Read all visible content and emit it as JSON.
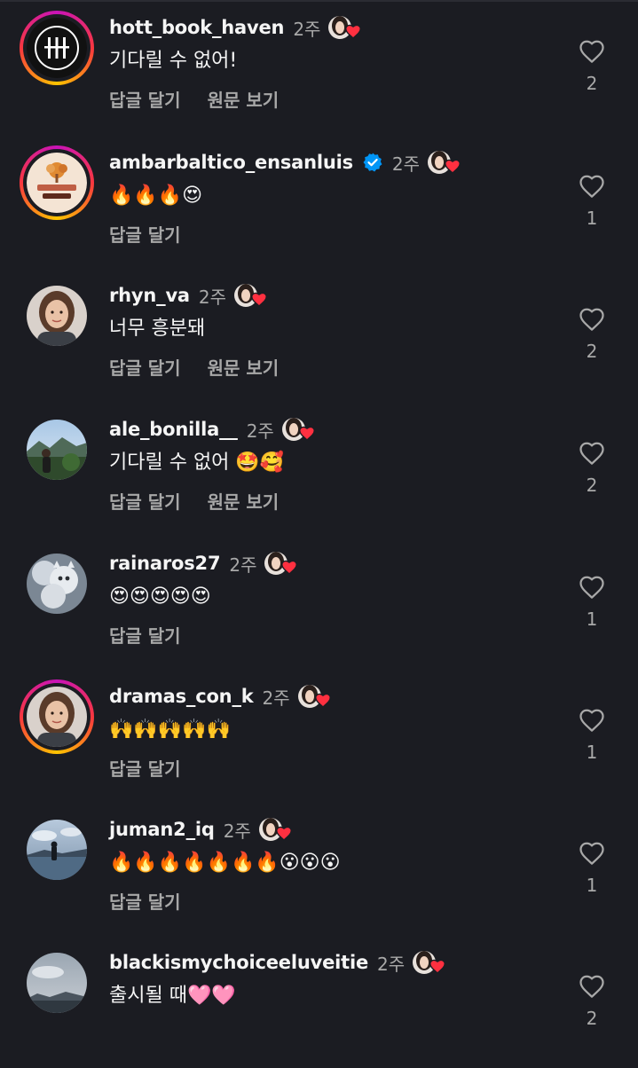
{
  "comments": [
    {
      "username": "hott_book_haven",
      "verified": false,
      "time": "2주",
      "text": "기다릴 수 없어!",
      "reply_label": "답글 달기",
      "translate_label": "원문 보기",
      "likes": "2",
      "story_ring": true,
      "avatar_icon": "books-logo"
    },
    {
      "username": "ambarbaltico_ensanluis",
      "verified": true,
      "time": "2주",
      "text": "🔥🔥🔥😍",
      "reply_label": "답글 달기",
      "translate_label": "",
      "likes": "1",
      "story_ring": true,
      "avatar_icon": "tree-logo"
    },
    {
      "username": "rhyn_va",
      "verified": false,
      "time": "2주",
      "text": "너무 흥분돼",
      "reply_label": "답글 달기",
      "translate_label": "원문 보기",
      "likes": "2",
      "story_ring": false,
      "avatar_icon": "person-photo"
    },
    {
      "username": "ale_bonilla__",
      "verified": false,
      "time": "2주",
      "text": "기다릴 수 없어 🤩🥰",
      "reply_label": "답글 달기",
      "translate_label": "원문 보기",
      "likes": "2",
      "story_ring": false,
      "avatar_icon": "landscape-photo"
    },
    {
      "username": "rainaros27",
      "verified": false,
      "time": "2주",
      "text": "😍😍😍😍😍",
      "reply_label": "답글 달기",
      "translate_label": "",
      "likes": "1",
      "story_ring": false,
      "avatar_icon": "cat-photo"
    },
    {
      "username": "dramas_con_k",
      "verified": false,
      "time": "2주",
      "text": "🙌🙌🙌🙌🙌",
      "reply_label": "답글 달기",
      "translate_label": "",
      "likes": "1",
      "story_ring": true,
      "avatar_icon": "person-photo"
    },
    {
      "username": "juman2_iq",
      "verified": false,
      "time": "2주",
      "text": "🔥🔥🔥🔥🔥🔥🔥😮😮😮",
      "reply_label": "답글 달기",
      "translate_label": "",
      "likes": "1",
      "story_ring": false,
      "avatar_icon": "lake-photo"
    },
    {
      "username": "blackismychoiceeluveitie",
      "verified": false,
      "time": "2주",
      "text": "출시될 때🩷🩷",
      "reply_label": "",
      "translate_label": "",
      "likes": "2",
      "story_ring": false,
      "avatar_icon": "sky-photo"
    }
  ],
  "icons": {
    "like": "heart-outline-icon",
    "verified": "verified-badge-icon",
    "creator_liked": "creator-liked-heart-icon"
  },
  "colors": {
    "background": "#1b1c22",
    "primary_text": "#f5f5f5",
    "secondary_text": "#a8a8a8",
    "verified_blue": "#0095f6",
    "like_red": "#ff3040"
  }
}
